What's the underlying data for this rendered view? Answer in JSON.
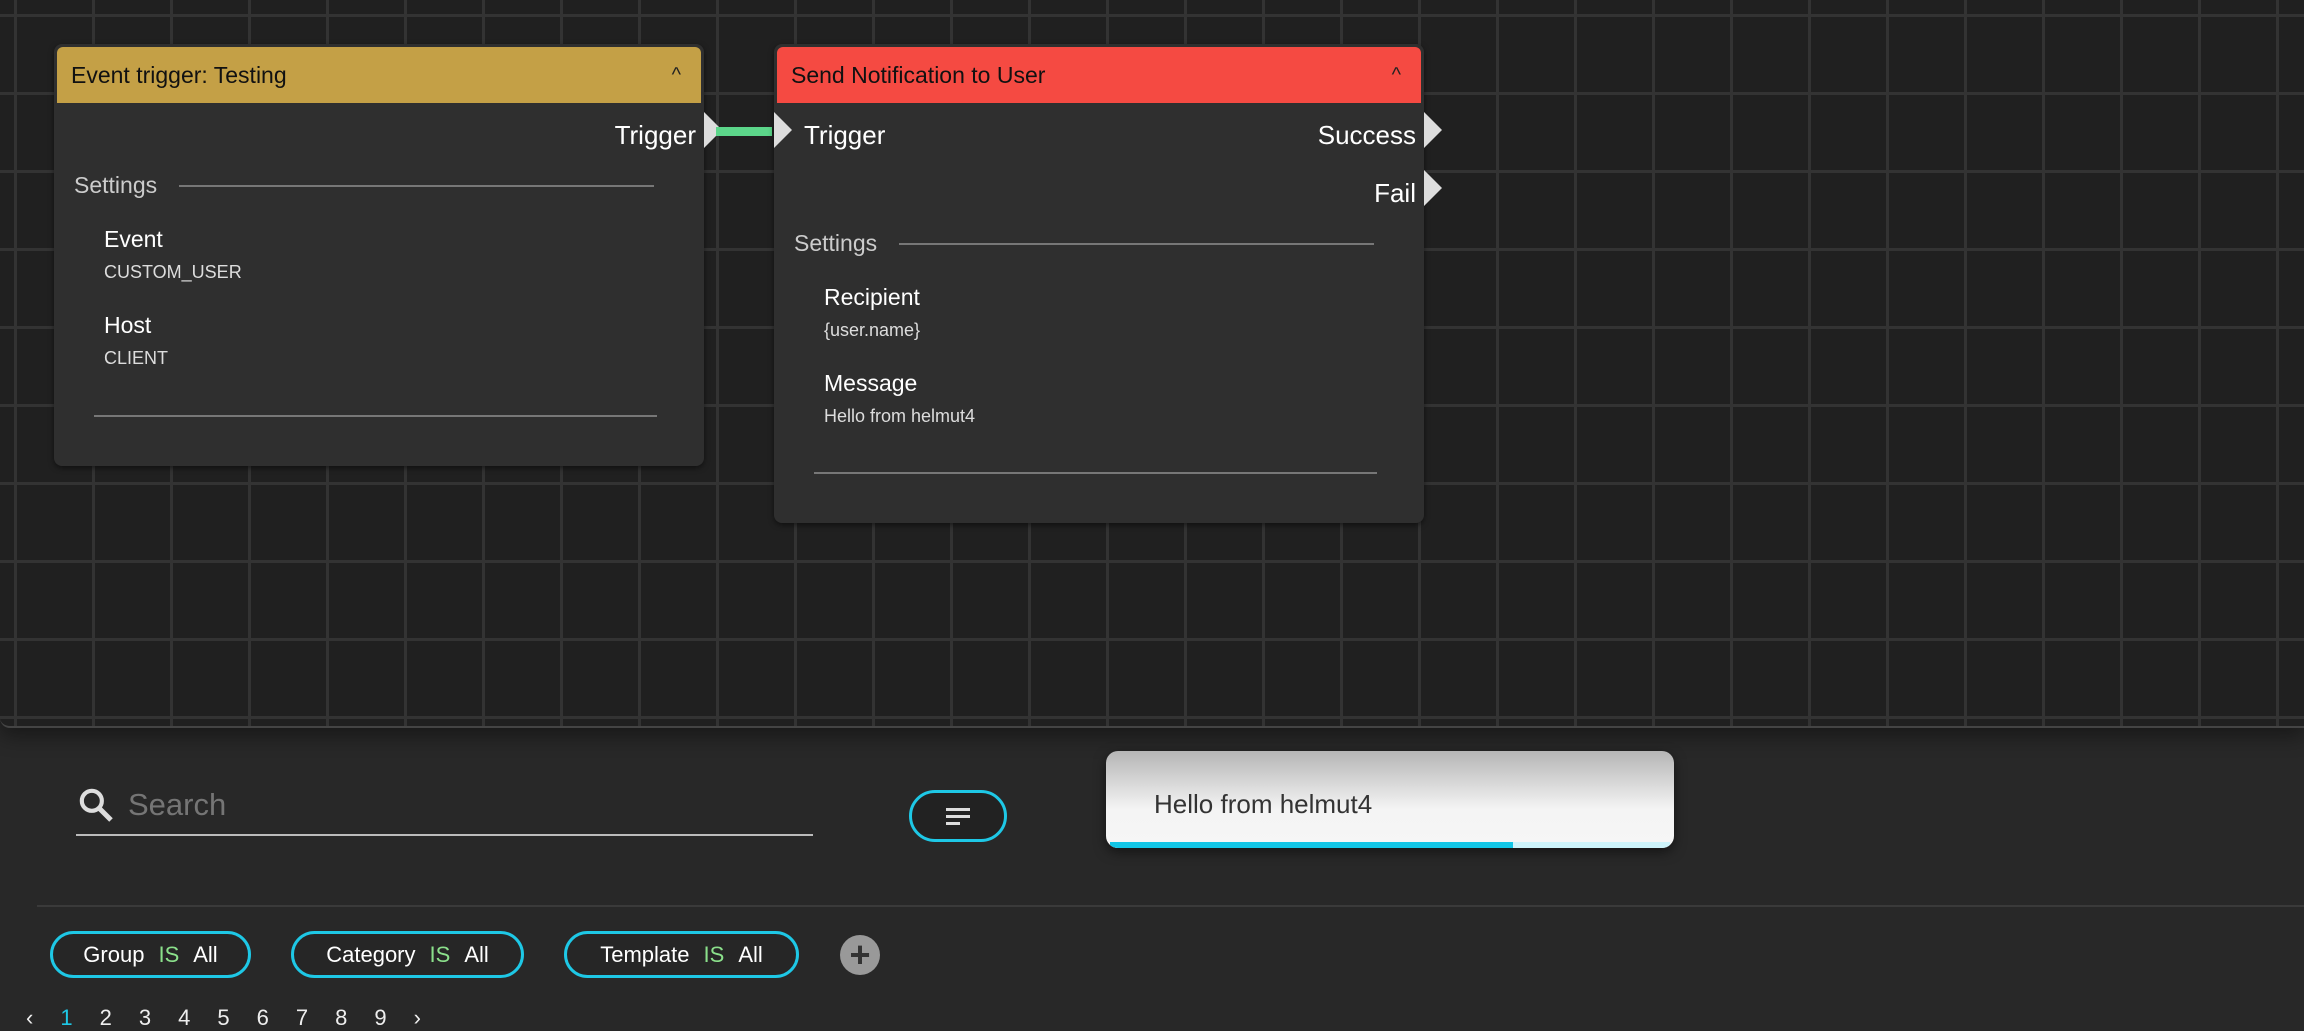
{
  "nodes": [
    {
      "title": "Event trigger: Testing",
      "header_color": "#c4a046",
      "outputs": [
        "Trigger"
      ],
      "section": "Settings",
      "fields": [
        {
          "label": "Event",
          "value": "CUSTOM_USER"
        },
        {
          "label": "Host",
          "value": "CLIENT"
        }
      ]
    },
    {
      "title": "Send Notification to User",
      "header_color": "#f54a42",
      "inputs": [
        "Trigger"
      ],
      "outputs": [
        "Success",
        "Fail"
      ],
      "section": "Settings",
      "fields": [
        {
          "label": "Recipient",
          "value": "{user.name}"
        },
        {
          "label": "Message",
          "value": "Hello from helmut4"
        }
      ]
    }
  ],
  "connection_color": "#5cd68a",
  "search": {
    "placeholder": "Search",
    "icon": "search-icon"
  },
  "filter_button": {
    "icon": "sort-lines-icon"
  },
  "toast": {
    "message": "Hello from helmut4",
    "progress_percent": 72
  },
  "chips": [
    {
      "field": "Group",
      "op": "IS",
      "value": "All"
    },
    {
      "field": "Category",
      "op": "IS",
      "value": "All"
    },
    {
      "field": "Template",
      "op": "IS",
      "value": "All"
    }
  ],
  "pagination": {
    "prev": "‹",
    "pages": [
      "1",
      "2",
      "3",
      "4",
      "5",
      "6",
      "7",
      "8",
      "9"
    ],
    "current": "1",
    "next": "›"
  },
  "accent": "#1ec8e6"
}
